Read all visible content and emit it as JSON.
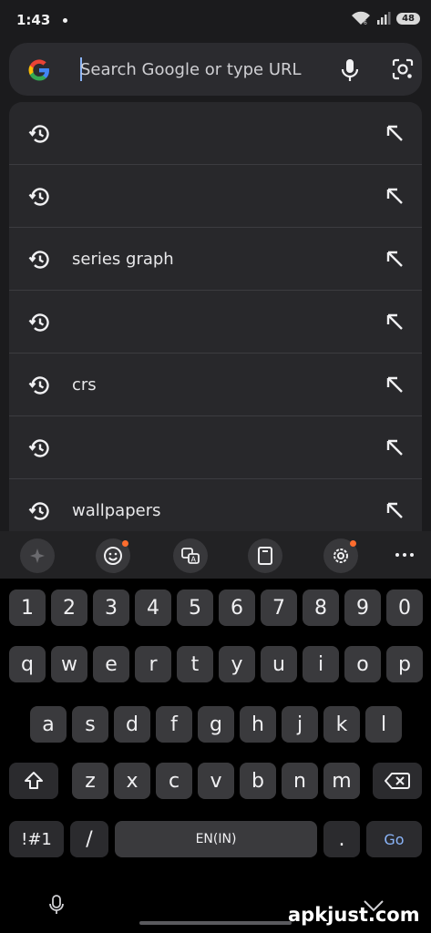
{
  "status_bar": {
    "time": "1:43",
    "battery": "48"
  },
  "search": {
    "placeholder": "Search Google or type URL",
    "value": ""
  },
  "suggestions": [
    {
      "text": ""
    },
    {
      "text": ""
    },
    {
      "text": "series graph"
    },
    {
      "text": ""
    },
    {
      "text": "crs"
    },
    {
      "text": ""
    },
    {
      "text": "wallpapers"
    }
  ],
  "keyboard": {
    "number_row": [
      "1",
      "2",
      "3",
      "4",
      "5",
      "6",
      "7",
      "8",
      "9",
      "0"
    ],
    "row1": [
      "q",
      "w",
      "e",
      "r",
      "t",
      "y",
      "u",
      "i",
      "o",
      "p"
    ],
    "row2": [
      "a",
      "s",
      "d",
      "f",
      "g",
      "h",
      "j",
      "k",
      "l"
    ],
    "row3": [
      "z",
      "x",
      "c",
      "v",
      "b",
      "n",
      "m"
    ],
    "symbols_label": "!#1",
    "slash_label": "/",
    "space_label": "EN(IN)",
    "period_label": ".",
    "go_label": "Go"
  },
  "watermark": "apkjust.com",
  "colors": {
    "accent": "#8ab4f8",
    "notification_dot": "#ff6d2e"
  }
}
